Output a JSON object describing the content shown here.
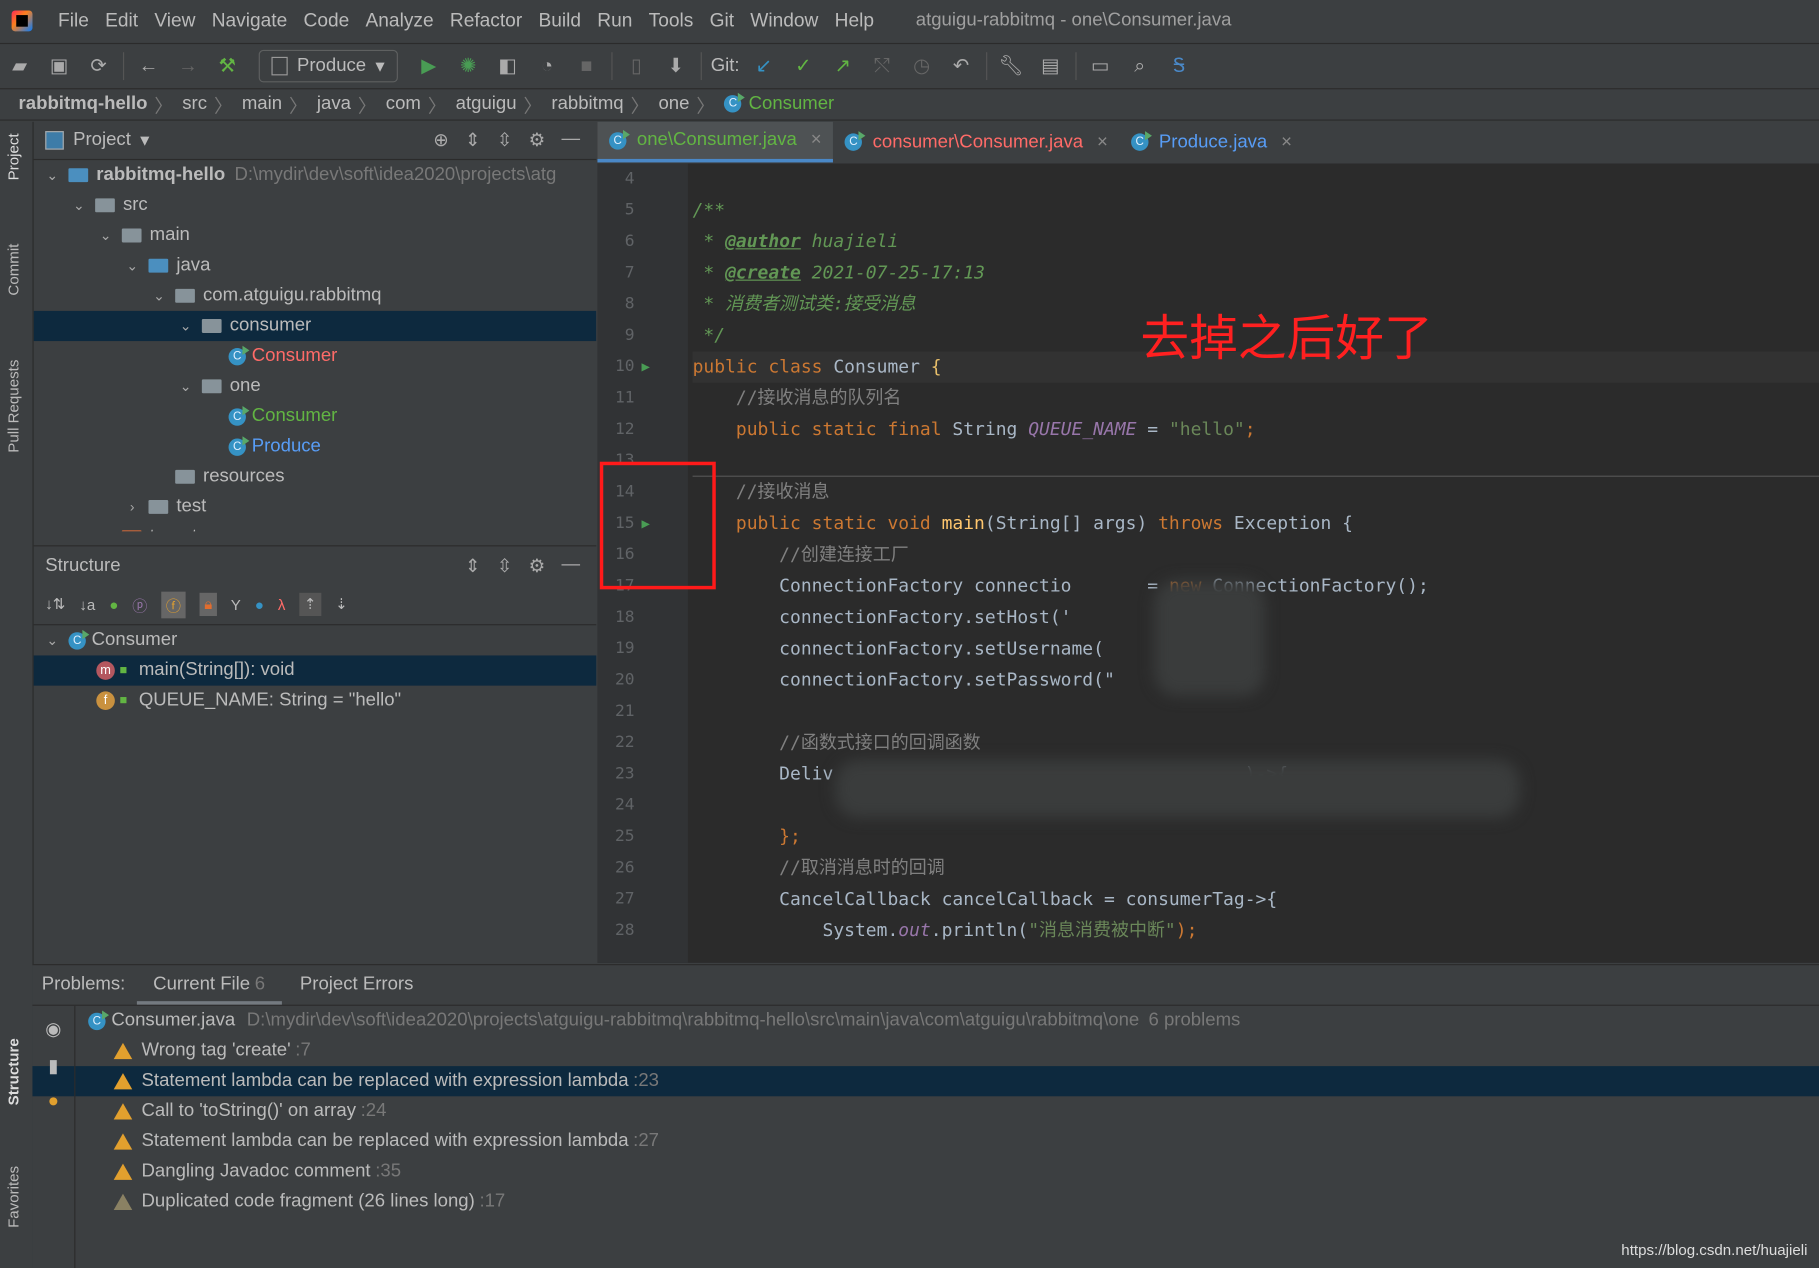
{
  "menu": {
    "items": [
      "File",
      "Edit",
      "View",
      "Navigate",
      "Code",
      "Analyze",
      "Refactor",
      "Build",
      "Run",
      "Tools",
      "Git",
      "Window",
      "Help"
    ],
    "title": "atguigu-rabbitmq - one\\Consumer.java"
  },
  "toolbar": {
    "run_config": "Produce",
    "git_label": "Git:"
  },
  "breadcrumb": [
    "rabbitmq-hello",
    "src",
    "main",
    "java",
    "com",
    "atguigu",
    "rabbitmq",
    "one",
    "Consumer"
  ],
  "side_strip": {
    "project": "Project",
    "commit": "Commit",
    "pull_requests": "Pull Requests",
    "structure": "Structure",
    "favorites": "Favorites"
  },
  "project_panel": {
    "title": "Project",
    "tree": [
      {
        "label": "rabbitmq-hello",
        "extra": "D:\\mydir\\dev\\soft\\idea2020\\projects\\atg",
        "depth": 0,
        "type": "module",
        "open": true
      },
      {
        "label": "src",
        "depth": 1,
        "type": "folder",
        "open": true
      },
      {
        "label": "main",
        "depth": 2,
        "type": "folder",
        "open": true
      },
      {
        "label": "java",
        "depth": 3,
        "type": "srcfolder",
        "open": true
      },
      {
        "label": "com.atguigu.rabbitmq",
        "depth": 4,
        "type": "package",
        "open": true
      },
      {
        "label": "consumer",
        "depth": 5,
        "type": "package",
        "open": true,
        "selected": true
      },
      {
        "label": "Consumer",
        "depth": 6,
        "type": "class",
        "color": "red"
      },
      {
        "label": "one",
        "depth": 5,
        "type": "package",
        "open": true
      },
      {
        "label": "Consumer",
        "depth": 6,
        "type": "class",
        "color": "green"
      },
      {
        "label": "Produce",
        "depth": 6,
        "type": "class",
        "color": "blue"
      },
      {
        "label": "resources",
        "depth": 4,
        "type": "resfolder"
      },
      {
        "label": "test",
        "depth": 3,
        "type": "folder",
        "open": false
      },
      {
        "label": "target",
        "depth": 2,
        "type": "excluded",
        "open": false
      }
    ]
  },
  "structure_panel": {
    "title": "Structure",
    "root": "Consumer",
    "items": [
      {
        "label": "main(String[]): void",
        "icon": "m",
        "selected": true
      },
      {
        "label": "QUEUE_NAME: String = \"hello\"",
        "icon": "f"
      }
    ]
  },
  "tabs": [
    {
      "label": "one\\Consumer.java",
      "color": "#62b543",
      "active": true
    },
    {
      "label": "consumer\\Consumer.java",
      "color": "#ff6b68"
    },
    {
      "label": "Produce.java",
      "color": "#589df6"
    }
  ],
  "editor": {
    "lines": [
      {
        "n": "4",
        "t": []
      },
      {
        "n": "5",
        "t": [
          [
            "/**",
            "doc"
          ]
        ]
      },
      {
        "n": "6",
        "t": [
          [
            " * ",
            "doc"
          ],
          [
            "@author",
            "tag"
          ],
          [
            " huajieli",
            "doc"
          ]
        ]
      },
      {
        "n": "7",
        "t": [
          [
            " * ",
            "doc"
          ],
          [
            "@create",
            "tag"
          ],
          [
            " 2021-07-25-17:13",
            "doc"
          ]
        ]
      },
      {
        "n": "8",
        "t": [
          [
            " * 消费者测试类:接受消息",
            "doc"
          ]
        ]
      },
      {
        "n": "9",
        "t": [
          [
            " */",
            "doc"
          ]
        ]
      },
      {
        "n": "10",
        "t": [
          [
            "public class ",
            "kw"
          ],
          [
            "Consumer ",
            "id"
          ],
          [
            "{",
            "br"
          ]
        ],
        "run": true
      },
      {
        "n": "11",
        "t": [
          [
            "    //接收消息的队列名",
            "cm"
          ]
        ]
      },
      {
        "n": "12",
        "t": [
          [
            "    public static final ",
            "kw"
          ],
          [
            "String ",
            "id"
          ],
          [
            "QUEUE_NAME",
            "cst"
          ],
          [
            " = ",
            "id"
          ],
          [
            "\"hello\"",
            "str"
          ],
          [
            ";",
            "kw"
          ]
        ]
      },
      {
        "n": "13",
        "t": []
      },
      {
        "n": "14",
        "t": [
          [
            "    //接收消息",
            "cm"
          ]
        ]
      },
      {
        "n": "15",
        "t": [
          [
            "    public static void ",
            "kw"
          ],
          [
            "main",
            "fn"
          ],
          [
            "(String[] args) ",
            "id"
          ],
          [
            "throws ",
            "kw"
          ],
          [
            "Exception {",
            "id"
          ]
        ],
        "run": true
      },
      {
        "n": "16",
        "t": [
          [
            "        //创建连接工厂",
            "cm"
          ]
        ]
      },
      {
        "n": "17",
        "t": [
          [
            "        ConnectionFactory connectio",
            "id"
          ],
          [
            "       = ",
            "id"
          ],
          [
            "new ",
            "kw"
          ],
          [
            "ConnectionFactory();",
            "id"
          ]
        ]
      },
      {
        "n": "18",
        "t": [
          [
            "        connectionFactory.setHost('",
            "id"
          ],
          [
            "          .10\");",
            "str"
          ]
        ]
      },
      {
        "n": "19",
        "t": [
          [
            "        connectionFactory.setUsername(",
            "id"
          ],
          [
            "         ;",
            "kw"
          ]
        ]
      },
      {
        "n": "20",
        "t": [
          [
            "        connectionFactory.setPassword(\"",
            "id"
          ]
        ]
      },
      {
        "n": "21",
        "t": []
      },
      {
        "n": "22",
        "t": [
          [
            "        //函数式接口的回调函数",
            "cm"
          ]
        ]
      },
      {
        "n": "23",
        "t": [
          [
            "        Deliv",
            "id"
          ],
          [
            "                                      )->{",
            "id"
          ]
        ]
      },
      {
        "n": "24",
        "t": []
      },
      {
        "n": "25",
        "t": [
          [
            "        };",
            "kw"
          ]
        ]
      },
      {
        "n": "26",
        "t": [
          [
            "        //取消消息时的回调",
            "cm"
          ]
        ]
      },
      {
        "n": "27",
        "t": [
          [
            "        CancelCallback cancelCallback = consumerTag->{",
            "id"
          ]
        ]
      },
      {
        "n": "28",
        "t": [
          [
            "            System.",
            "id"
          ],
          [
            "out",
            "cst"
          ],
          [
            ".println(",
            "id"
          ],
          [
            "\"消息消费被中断\"",
            "str"
          ],
          [
            ");",
            "kw"
          ]
        ]
      }
    ],
    "annotation": "去掉之后好了"
  },
  "problems": {
    "label": "Problems:",
    "tabs": [
      {
        "label": "Current File",
        "count": "6",
        "active": true
      },
      {
        "label": "Project Errors"
      }
    ],
    "file": {
      "name": "Consumer.java",
      "path": "D:\\mydir\\dev\\soft\\idea2020\\projects\\atguigu-rabbitmq\\rabbitmq-hello\\src\\main\\java\\com\\atguigu\\rabbitmq\\one",
      "count": "6 problems"
    },
    "items": [
      {
        "text": "Wrong tag 'create'",
        "line": ":7"
      },
      {
        "text": "Statement lambda can be replaced with expression lambda",
        "line": ":23",
        "selected": true
      },
      {
        "text": "Call to 'toString()' on array",
        "line": ":24"
      },
      {
        "text": "Statement lambda can be replaced with expression lambda",
        "line": ":27"
      },
      {
        "text": "Dangling Javadoc comment",
        "line": ":35"
      },
      {
        "text": "Duplicated code fragment (26 lines long)",
        "line": ":17",
        "weak": true
      }
    ]
  },
  "watermark": "https://blog.csdn.net/huajieli"
}
